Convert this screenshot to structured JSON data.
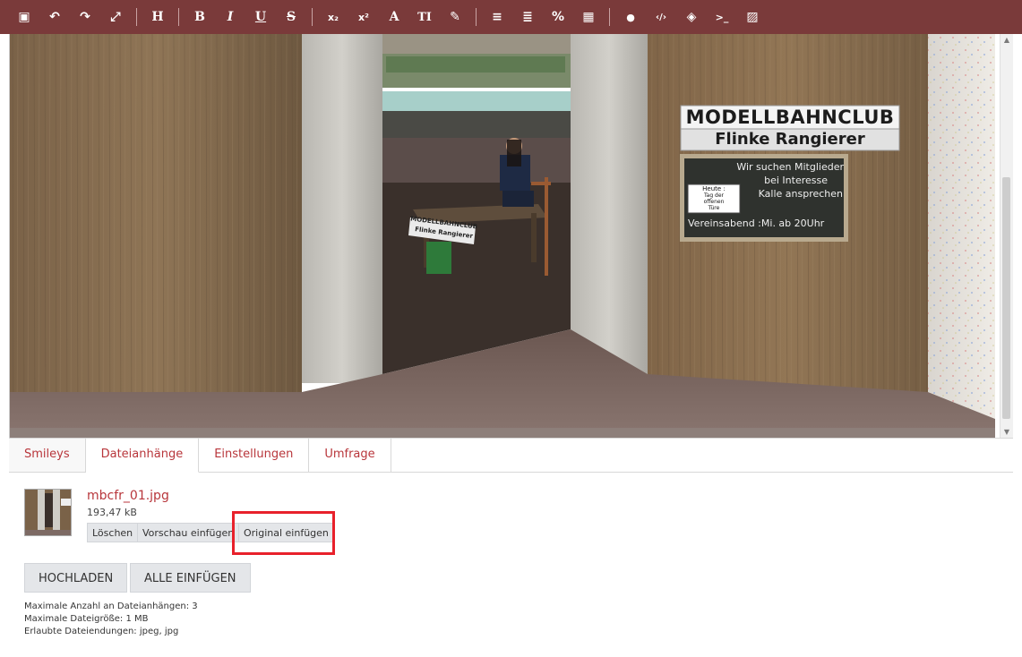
{
  "toolbar": {
    "background": "#7a3a3a",
    "buttons": [
      {
        "name": "source-icon",
        "glyph": "▣"
      },
      {
        "name": "undo-icon",
        "glyph": "↶"
      },
      {
        "name": "redo-icon",
        "glyph": "↷"
      },
      {
        "name": "fullscreen-icon",
        "glyph": "⤢"
      },
      {
        "name": "heading-icon",
        "glyph": "H"
      },
      {
        "name": "bold-icon",
        "glyph": "B"
      },
      {
        "name": "italic-icon",
        "glyph": "I"
      },
      {
        "name": "underline-icon",
        "glyph": "U"
      },
      {
        "name": "strikethrough-icon",
        "glyph": "S"
      },
      {
        "name": "subscript-icon",
        "glyph": "x₂"
      },
      {
        "name": "superscript-icon",
        "glyph": "x²"
      },
      {
        "name": "font-color-icon",
        "glyph": "A"
      },
      {
        "name": "font-size-icon",
        "glyph": "TI"
      },
      {
        "name": "brush-icon",
        "glyph": "✎"
      },
      {
        "name": "list-icon",
        "glyph": "≡"
      },
      {
        "name": "align-icon",
        "glyph": "≣"
      },
      {
        "name": "link-icon",
        "glyph": "%"
      },
      {
        "name": "table-icon",
        "glyph": "▦"
      },
      {
        "name": "quote-icon",
        "glyph": "●"
      },
      {
        "name": "code-icon",
        "glyph": "‹/›"
      },
      {
        "name": "spoiler-icon",
        "glyph": "◈"
      },
      {
        "name": "terminal-icon",
        "glyph": ">_"
      },
      {
        "name": "image-icon",
        "glyph": "▨"
      }
    ]
  },
  "scene": {
    "sign_title": "MODELLBAHNCLUB",
    "sign_subtitle": "Flinke Rangierer",
    "board_line1": "Wir suchen Mitglieder",
    "board_line2": "bei Interesse",
    "board_line3": "Kalle ansprechen",
    "board_note1": "Heute :",
    "board_note2": "Tag der",
    "board_note3": "offenen",
    "board_note4": "Türe",
    "board_line4": "Vereinsabend :Mi. ab 20Uhr",
    "table_sign1": "MODELLBAHNCLUB",
    "table_sign2": "Flinke Rangierer"
  },
  "tabs": [
    {
      "label": "Smileys",
      "active": false
    },
    {
      "label": "Dateianhänge",
      "active": true
    },
    {
      "label": "Einstellungen",
      "active": false
    },
    {
      "label": "Umfrage",
      "active": false
    }
  ],
  "attachment": {
    "filename": "mbcfr_01.jpg",
    "filesize": "193,47 kB",
    "delete_label": "Löschen",
    "preview_label": "Vorschau einfügen",
    "original_label": "Original einfügen"
  },
  "buttons": {
    "upload": "HOCHLADEN",
    "insert_all": "ALLE EINFÜGEN"
  },
  "info": {
    "max_count": "Maximale Anzahl an Dateianhängen: 3",
    "max_size": "Maximale Dateigröße: 1 MB",
    "extensions": "Erlaubte Dateiendungen: jpeg, jpg"
  },
  "colors": {
    "accent": "#b8363b",
    "highlight": "#e8212b"
  }
}
